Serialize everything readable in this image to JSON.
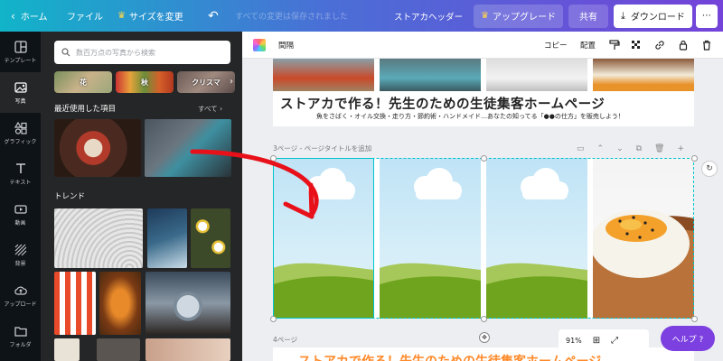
{
  "topbar": {
    "home": "ホーム",
    "file": "ファイル",
    "resize": "サイズを変更",
    "saved_status": "すべての変更は保存されました",
    "doc_title": "ストアカヘッダー",
    "upgrade": "アップグレード",
    "share": "共有",
    "download": "ダウンロード"
  },
  "rail": {
    "items": [
      {
        "label": "テンプレート",
        "icon": "template-icon"
      },
      {
        "label": "写真",
        "icon": "photo-icon"
      },
      {
        "label": "グラフィック",
        "icon": "graphics-icon"
      },
      {
        "label": "テキスト",
        "icon": "text-icon"
      },
      {
        "label": "動画",
        "icon": "video-icon"
      },
      {
        "label": "背景",
        "icon": "background-icon"
      },
      {
        "label": "アップロード",
        "icon": "upload-icon"
      },
      {
        "label": "フォルダ",
        "icon": "folder-icon"
      }
    ]
  },
  "panel": {
    "search_placeholder": "数百万点の写真から検索",
    "chips": [
      "花",
      "秋",
      "クリスマ"
    ],
    "recent_title": "最近使用した項目",
    "recent_all": "すべて",
    "trend_title": "トレンド"
  },
  "context_bar": {
    "spacing": "間隔",
    "copy": "コピー",
    "arrange": "配置"
  },
  "canvas": {
    "banner_title": "ストアカで作る！先生のための生徒集客ホームページ",
    "banner_sub": "魚をさばく・オイル交換・走り方・節約術・ハンドメイド…あなたの知ってる「●●の仕方」を販売しよう！",
    "page3_label": "3ページ - ページタイトルを追加",
    "page4_label": "4ページ",
    "page4_title": "ストアカで作る！先生のための生徒集客ホームページ"
  },
  "bottom": {
    "zoom": "91%",
    "help": "ヘルプ ?"
  },
  "colors": {
    "rail_bg": "#0e1318",
    "panel_bg": "#252627",
    "help_purple": "#7c3fe0",
    "selection_cyan": "#00c4cc",
    "arrow_red": "#e8111a",
    "page4_title_orange": "#ff8a2a"
  }
}
